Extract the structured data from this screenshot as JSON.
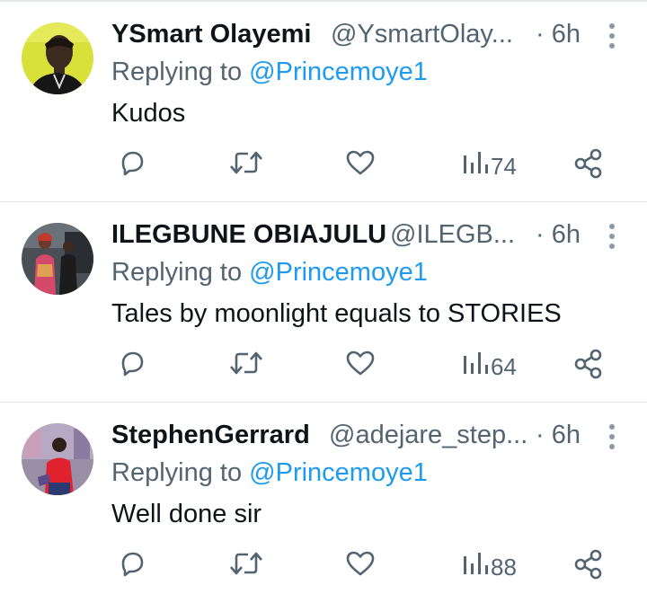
{
  "tweets": [
    {
      "name": "YSmart Olayemi",
      "handle": "@YsmartOlay...",
      "time": "· 6h",
      "replying_prefix": "Replying to ",
      "replying_to": "@Princemoye1",
      "text": "Kudos",
      "views": "74",
      "avatar": "avatar"
    },
    {
      "name": "ILEGBUNE OBIAJULU",
      "handle": "@ILEGB...",
      "time": "· 6h",
      "replying_prefix": "Replying to ",
      "replying_to": "@Princemoye1",
      "text": "Tales by moonlight equals to STORIES",
      "views": "64",
      "avatar": "avatar"
    },
    {
      "name": "StephenGerrard",
      "handle": "@adejare_step...",
      "time": "· 6h",
      "replying_prefix": "Replying to ",
      "replying_to": "@Princemoye1",
      "text": "Well done sir",
      "views": "88",
      "avatar": "avatar"
    }
  ],
  "icons": {
    "reply": "reply-icon",
    "retweet": "retweet-icon",
    "like": "heart-icon",
    "views": "views-icon",
    "share": "share-icon",
    "more": "more-icon"
  },
  "colors": {
    "text": "#0f1419",
    "secondary": "#536471",
    "mention": "#1d9bf0",
    "avatar_bg_1": "#d8e03a"
  }
}
